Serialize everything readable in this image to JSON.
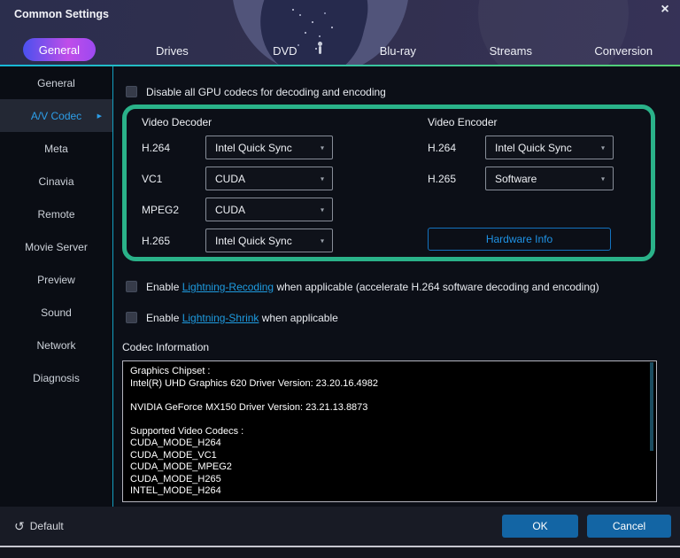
{
  "window": {
    "title": "Common Settings"
  },
  "icons": {
    "close": "×",
    "caret": "▾",
    "arrow_right": "▶",
    "reset": "↺"
  },
  "tabs": [
    {
      "label": "General",
      "active": true
    },
    {
      "label": "Drives"
    },
    {
      "label": "DVD"
    },
    {
      "label": "Blu-ray"
    },
    {
      "label": "Streams"
    },
    {
      "label": "Conversion"
    }
  ],
  "sidebar": {
    "items": [
      {
        "label": "General"
      },
      {
        "label": "A/V Codec",
        "active": true
      },
      {
        "label": "Meta"
      },
      {
        "label": "Cinavia"
      },
      {
        "label": "Remote"
      },
      {
        "label": "Movie Server"
      },
      {
        "label": "Preview"
      },
      {
        "label": "Sound"
      },
      {
        "label": "Network"
      },
      {
        "label": "Diagnosis"
      }
    ]
  },
  "content": {
    "disable_gpu_label": "Disable all GPU codecs for decoding and encoding",
    "decoder": {
      "title": "Video Decoder",
      "rows": [
        {
          "label": "H.264",
          "value": "Intel Quick Sync"
        },
        {
          "label": "VC1",
          "value": "CUDA"
        },
        {
          "label": "MPEG2",
          "value": "CUDA"
        },
        {
          "label": "H.265",
          "value": "Intel Quick Sync"
        }
      ]
    },
    "encoder": {
      "title": "Video Encoder",
      "rows": [
        {
          "label": "H.264",
          "value": "Intel Quick Sync"
        },
        {
          "label": "H.265",
          "value": "Software"
        }
      ],
      "hardware_info_label": "Hardware Info"
    },
    "recoding_checkbox": {
      "prefix": "Enable ",
      "link": "Lightning-Recoding",
      "suffix": " when applicable (accelerate H.264 software decoding and encoding)"
    },
    "shrink_checkbox": {
      "prefix": "Enable ",
      "link": "Lightning-Shrink",
      "suffix": " when applicable"
    },
    "codec_info_label": "Codec Information",
    "codec_info_text": "Graphics Chipset :\nIntel(R) UHD Graphics 620 Driver Version: 23.20.16.4982\n\nNVIDIA GeForce MX150 Driver Version: 23.21.13.8873\n\nSupported Video Codecs :\nCUDA_MODE_H264\nCUDA_MODE_VC1\nCUDA_MODE_MPEG2\nCUDA_MODE_H265\nINTEL_MODE_H264"
  },
  "footer": {
    "default_label": "Default",
    "ok_label": "OK",
    "cancel_label": "Cancel"
  },
  "colors": {
    "accent_green_border": "#2ab289",
    "accent_blue": "#1e9be0",
    "tab_gradient_start": "#4a51ee",
    "tab_gradient_end": "#9c49f1",
    "button_blue": "#1365a4",
    "header_line_start": "#17b8d8",
    "header_line_end": "#56d070"
  }
}
